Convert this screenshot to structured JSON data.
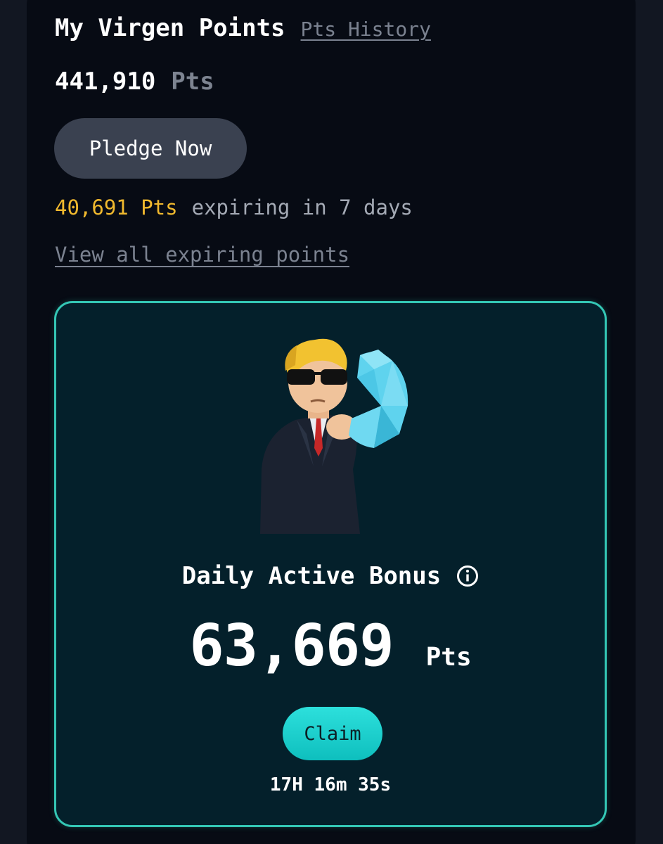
{
  "points": {
    "title": "My Virgen Points",
    "history_link": "Pts History",
    "total_value": "441,910",
    "total_unit": "Pts",
    "pledge_button": "Pledge Now",
    "expiring_amount": "40,691 Pts",
    "expiring_text": "expiring in 7 days",
    "expiring_link": "View all expiring points"
  },
  "bonus": {
    "title": "Daily Active Bonus",
    "info_icon": "info-icon",
    "amount": "63,669",
    "unit": "Pts",
    "claim_button": "Claim",
    "countdown": "17H 16m 35s",
    "mascot": "flexing-mascot-with-sunglasses"
  },
  "colors": {
    "background": "#070b14",
    "accent_gold": "#f0b92e",
    "card_border": "#34c7b5",
    "claim_button": "#1fd3cf",
    "muted_text": "#7b8290"
  }
}
